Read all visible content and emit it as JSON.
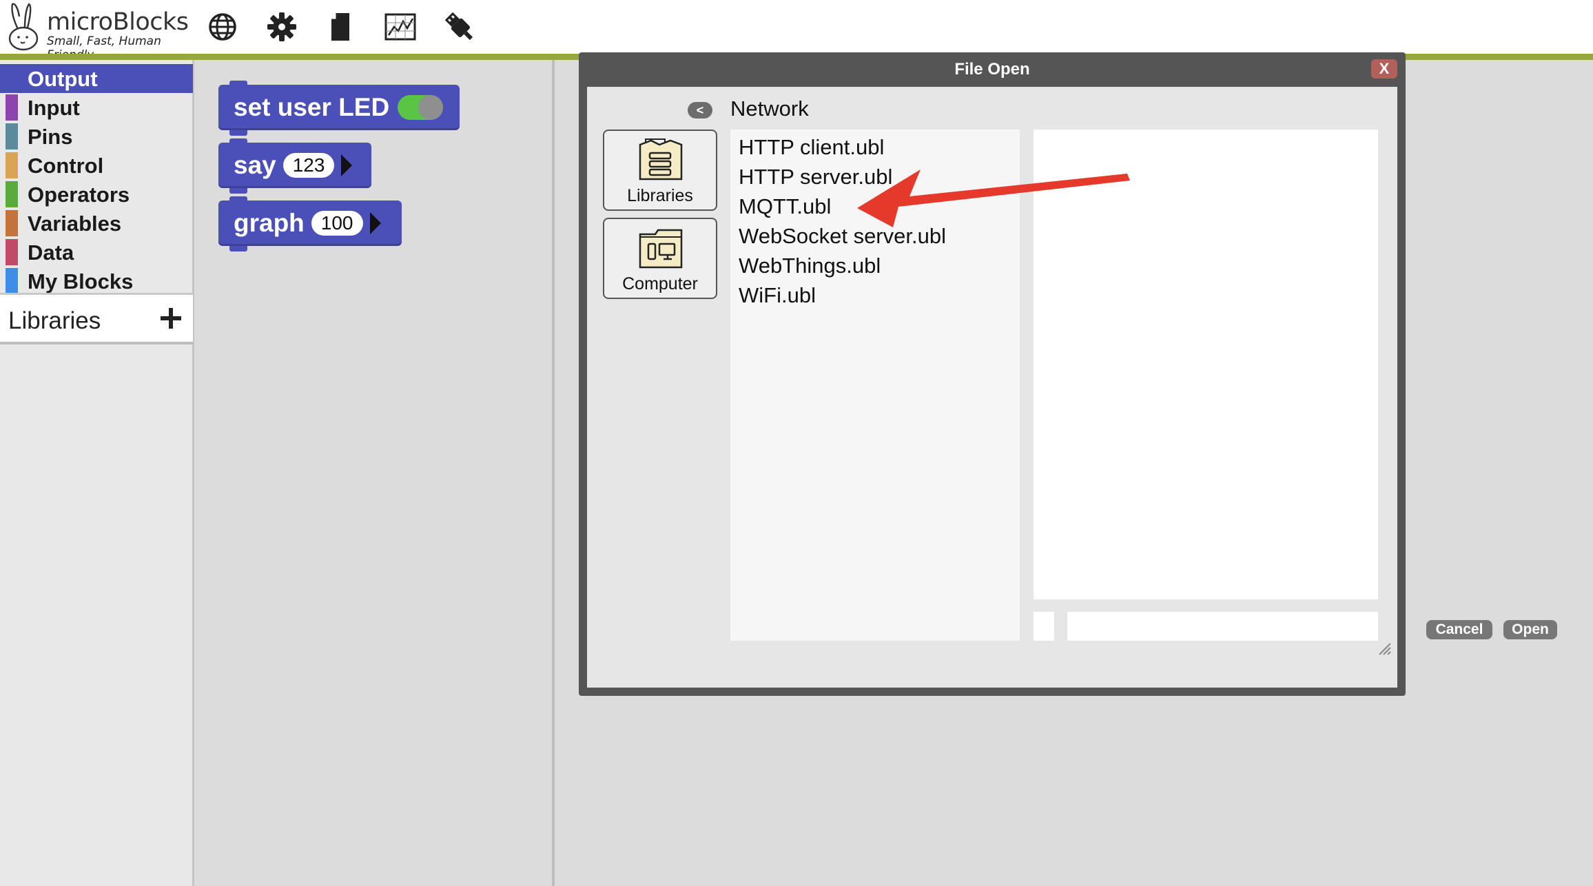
{
  "app": {
    "name": "microBlocks",
    "tagline": "Small, Fast, Human Friendly"
  },
  "toolbar": {
    "icons": [
      "globe-icon",
      "gear-icon",
      "file-icon",
      "graph-icon",
      "usb-icon"
    ]
  },
  "palette": {
    "categories": [
      {
        "label": "Output",
        "color": "#4b4fb8",
        "selected": true
      },
      {
        "label": "Input",
        "color": "#8e44ad"
      },
      {
        "label": "Pins",
        "color": "#5b8a9a"
      },
      {
        "label": "Control",
        "color": "#d8a553"
      },
      {
        "label": "Operators",
        "color": "#5aaa3c"
      },
      {
        "label": "Variables",
        "color": "#c4733a"
      },
      {
        "label": "Data",
        "color": "#c14b66"
      },
      {
        "label": "My Blocks",
        "color": "#3c8ee8"
      }
    ],
    "libraries_label": "Libraries"
  },
  "blocks": {
    "set_user_led": "set user LED",
    "say": "say",
    "say_value": "123",
    "graph": "graph",
    "graph_value": "100"
  },
  "dialog": {
    "title": "File Open",
    "close_label": "X",
    "back_label": "<",
    "current_folder": "Network",
    "places": [
      {
        "label": "Libraries",
        "icon": "libraries-icon"
      },
      {
        "label": "Computer",
        "icon": "computer-icon"
      }
    ],
    "files": [
      "HTTP client.ubl",
      "HTTP server.ubl",
      "MQTT.ubl",
      "WebSocket server.ubl",
      "WebThings.ubl",
      "WiFi.ubl"
    ],
    "filename_value": "",
    "cancel_label": "Cancel",
    "open_label": "Open"
  },
  "annotation": {
    "color": "#e53a2b",
    "points_to": "MQTT.ubl"
  }
}
